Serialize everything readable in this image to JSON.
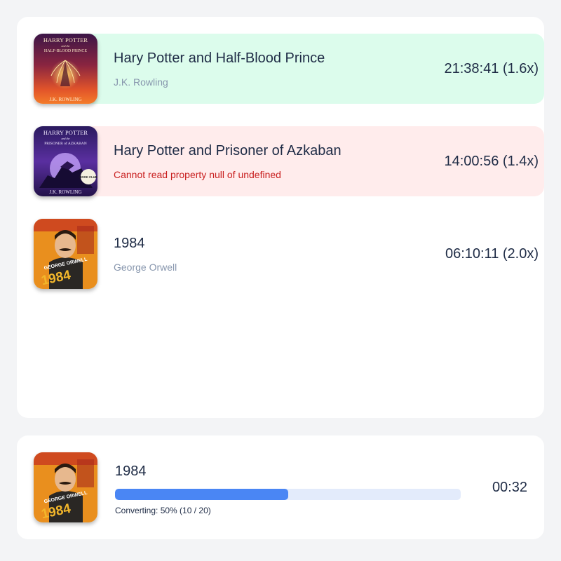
{
  "queue": [
    {
      "title": "Hary Potter and Half-Blood Prince",
      "subtitle": "J.K. Rowling",
      "duration": "21:38:41 (1.6x)",
      "state": "success",
      "cover": {
        "line1": "HARRY POTTER",
        "line2": "and the",
        "line3": "HALF-BLOOD PRINCE",
        "author": "J.K. ROWLING"
      }
    },
    {
      "title": "Hary Potter and Prisoner of Azkaban",
      "subtitle": "Cannot read property null of undefined",
      "duration": "14:00:56 (1.4x)",
      "state": "error",
      "cover": {
        "line1": "HARRY POTTER",
        "line2": "and the",
        "line3": "PRISONER of AZKABAN",
        "badge": "BOOK CLUB",
        "author": "J.K. ROWLING"
      }
    },
    {
      "title": "1984",
      "subtitle": "George Orwell",
      "duration": "06:10:11 (2.0x)",
      "state": "plain",
      "cover": {
        "author": "GEORGE ORWELL",
        "number": "1984"
      }
    }
  ],
  "now_converting": {
    "title": "1984",
    "status": "Converting: 50% (10 / 20)",
    "progress": 0.5,
    "elapsed": "00:32",
    "cover": {
      "author": "GEORGE ORWELL",
      "number": "1984"
    }
  },
  "colors": {
    "success_bg": "#dcfcec",
    "error_bg": "#ffecec",
    "error_text": "#c81e1e",
    "progress_fill": "#4a86f4",
    "progress_track": "#e3ebfb"
  }
}
